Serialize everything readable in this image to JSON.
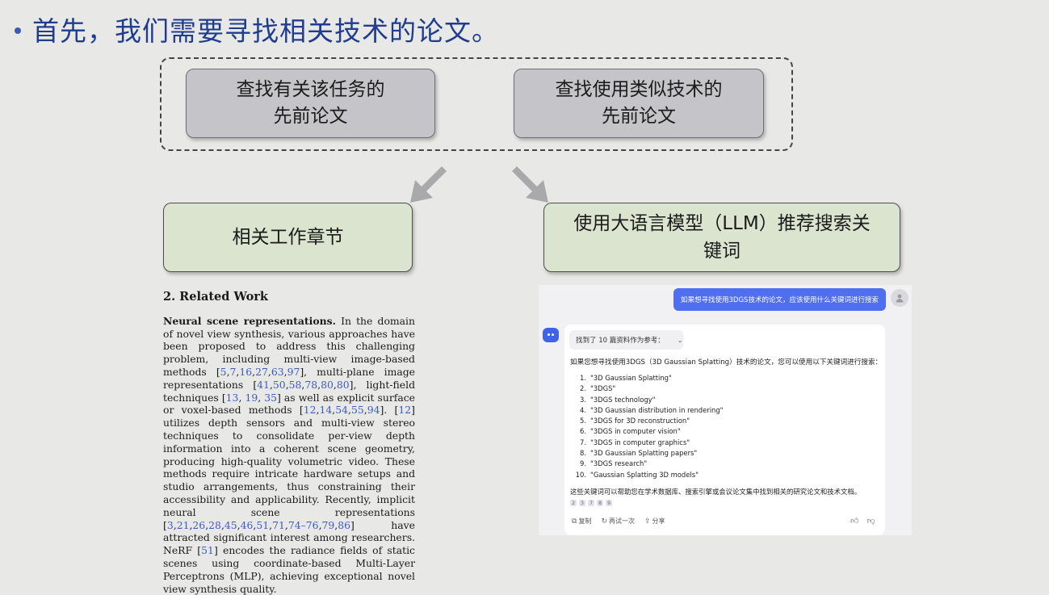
{
  "heading": "首先，我们需要寻找相关技术的论文。",
  "boxes": {
    "prior_task_line1": "查找有关该任务的",
    "prior_task_line2": "先前论文",
    "prior_tech_line1": "查找使用类似技术的",
    "prior_tech_line2": "先前论文",
    "related_work": "相关工作章节",
    "llm_line1": "使用大语言模型（LLM）推荐搜索关",
    "llm_line2": "键词"
  },
  "paper": {
    "section_title": "2. Related Work",
    "lead": "Neural scene representations.",
    "t1": " In the domain of novel view synthesis, various approaches have been proposed to address this challenging problem, including multi-view image-based methods [",
    "r1": "5",
    "r2": "7",
    "r3": "16",
    "r4": "27",
    "r5": "63",
    "r6": "97",
    "t2": "], multi-plane image representations [",
    "r7": "41",
    "r8": "50",
    "r9": "58",
    "r10": "78",
    "r11": "80",
    "r12": "80",
    "t3": "], light-field techniques [",
    "r13": "13",
    "r14": "19",
    "r15": "35",
    "t4": "] as well as explicit surface or voxel-based methods [",
    "r16": "12",
    "r17": "14",
    "r18": "54",
    "r19": "55",
    "r20": "94",
    "t5": "]. [",
    "r21": "12",
    "t6": "] utilizes depth sensors and multi-view stereo techniques to consolidate per-view depth information into a coherent scene geometry, producing high-quality volumetric video. These methods require intricate hardware setups and studio arrangements, thus constraining their accessibility and applicability. Recently, implicit neural scene representations [",
    "r22": "3",
    "r23": "21",
    "r24": "26",
    "r25": "28",
    "r26": "45",
    "r27": "46",
    "r28": "51",
    "r29": "71",
    "r30": "74–76",
    "r31": "79",
    "r32": "86",
    "t7": "] have attracted significant interest among researchers. NeRF [",
    "r33": "51",
    "t8": "] encodes the radiance fields of static scenes using coordinate-based Multi-Layer Perceptrons (MLP), achieving exceptional novel view synthesis quality."
  },
  "chat": {
    "user_message": "如果想寻找使用3DGS技术的论文，应该使用什么关键词进行搜索",
    "sources_label": "找到了 10 篇资料作为参考：",
    "intro": "如果您想寻找使用3DGS（3D Gaussian Splatting）技术的论文，您可以使用以下关键词进行搜索：",
    "keywords": [
      {
        "num": "1.",
        "text": "\"3D Gaussian Splatting\""
      },
      {
        "num": "2.",
        "text": "\"3DGS\""
      },
      {
        "num": "3.",
        "text": "\"3DGS technology\""
      },
      {
        "num": "4.",
        "text": "\"3D Gaussian distribution in rendering\""
      },
      {
        "num": "5.",
        "text": "\"3DGS for 3D reconstruction\""
      },
      {
        "num": "6.",
        "text": "\"3DGS in computer vision\""
      },
      {
        "num": "7.",
        "text": "\"3DGS in computer graphics\""
      },
      {
        "num": "8.",
        "text": "\"3D Gaussian Splatting papers\""
      },
      {
        "num": "9.",
        "text": "\"3DGS research\""
      },
      {
        "num": "10.",
        "text": "\"Gaussian Splatting 3D models\""
      }
    ],
    "outro": "这些关键词可以帮助您在学术数据库、搜索引擎或会议论文集中找到相关的研究论文和技术文档。",
    "ref_chips": [
      "2",
      "3",
      "7",
      "8",
      "9"
    ],
    "copy_label": "复制",
    "regenerate_label": "再试一次",
    "share_label": "分享"
  }
}
